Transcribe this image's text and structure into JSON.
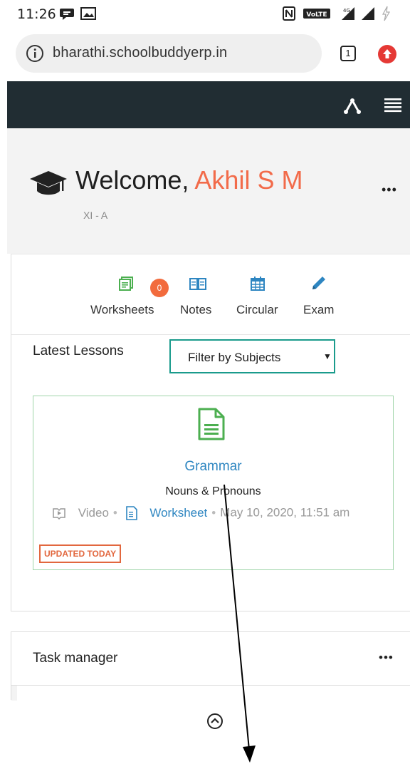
{
  "status_bar": {
    "time": "11:26"
  },
  "browser": {
    "url": "bharathi.schoolbuddyerp.in",
    "tabs_count": "1"
  },
  "welcome": {
    "greeting": "Welcome, ",
    "name": "Akhil S M",
    "class": "XI - A",
    "more": "•••"
  },
  "quick_links": {
    "items": [
      {
        "label": "Worksheets",
        "icon": "worksheets-icon",
        "badge": "0"
      },
      {
        "label": "Notes",
        "icon": "book-icon"
      },
      {
        "label": "Circular",
        "icon": "calendar-icon"
      },
      {
        "label": "Exam",
        "icon": "pencil-icon"
      }
    ]
  },
  "lessons": {
    "title": "Latest Lessons",
    "filter": "Filter by Subjects",
    "card": {
      "subject": "Grammar",
      "topic": "Nouns & Pronouns",
      "video_label": "Video",
      "worksheet_label": "Worksheet",
      "timestamp": "May 10, 2020, 11:51 am",
      "badge": "UPDATED TODAY"
    }
  },
  "task_manager": {
    "title": "Task manager",
    "more": "•••"
  },
  "colors": {
    "nav": "#212d33",
    "accent": "#f26b4a",
    "link": "#2e86c1",
    "teal": "#1a9b8c",
    "green_icon": "#4caf50"
  }
}
